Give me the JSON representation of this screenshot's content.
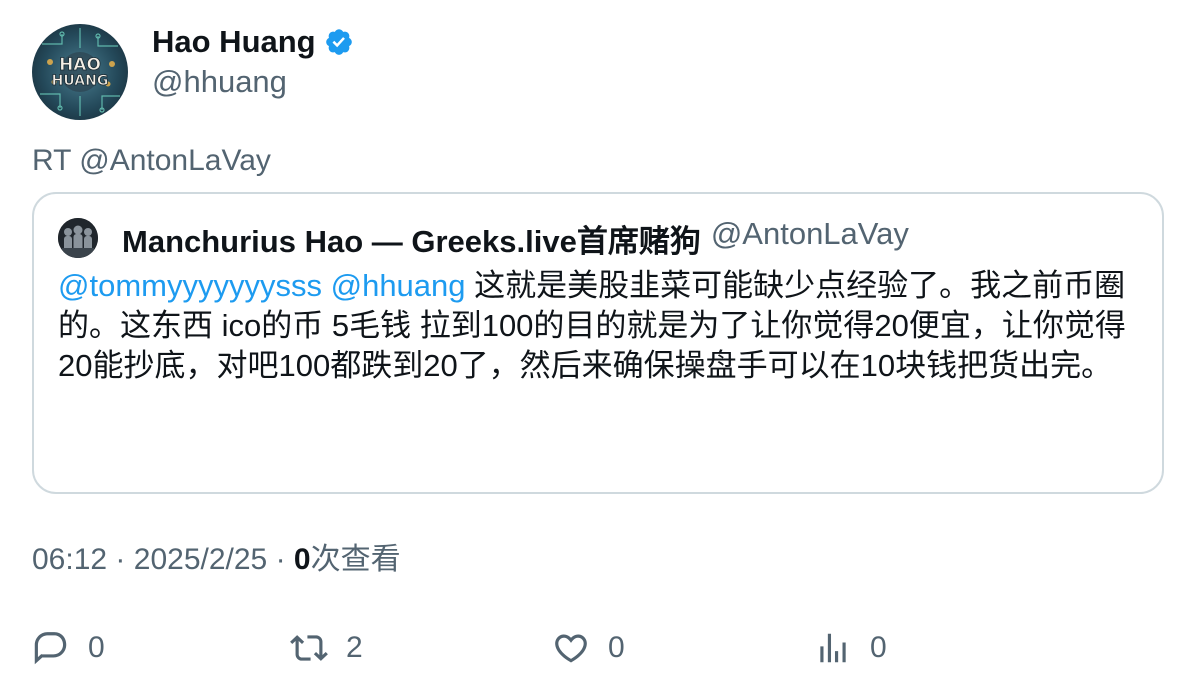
{
  "author": {
    "display_name": "Hao Huang",
    "handle": "@hhuang",
    "avatar_text_1": "HAO",
    "avatar_text_2": "HUANG",
    "verified_icon": "verified-badge-icon",
    "verified_color": "#1d9bf0"
  },
  "retweet_line": "RT @AntonLaVay",
  "quote": {
    "display_name": "Manchurius Hao — Greeks.live首席赌狗",
    "handle": "@AntonLaVay",
    "mention_1": "@tommyyyyyyysss",
    "mention_2": "@hhuang",
    "text": "这就是美股韭菜可能缺少点经验了。我之前币圈的。这东西 ico的币 5毛钱 拉到100的目的就是为了让你觉得20便宜，让你觉得20能抄底，对吧100都跌到20了，然后来确保操盘手可以在10块钱把货出完。"
  },
  "meta": {
    "time": "06:12",
    "separator": "·",
    "date": "2025/2/25",
    "views_count": "0",
    "views_label": "次查看"
  },
  "actions": {
    "reply_count": "0",
    "retweet_count": "2",
    "like_count": "0",
    "views_count": "0"
  },
  "colors": {
    "link": "#1d9bf0",
    "secondary_text": "#536471",
    "border": "#cfd9de"
  }
}
